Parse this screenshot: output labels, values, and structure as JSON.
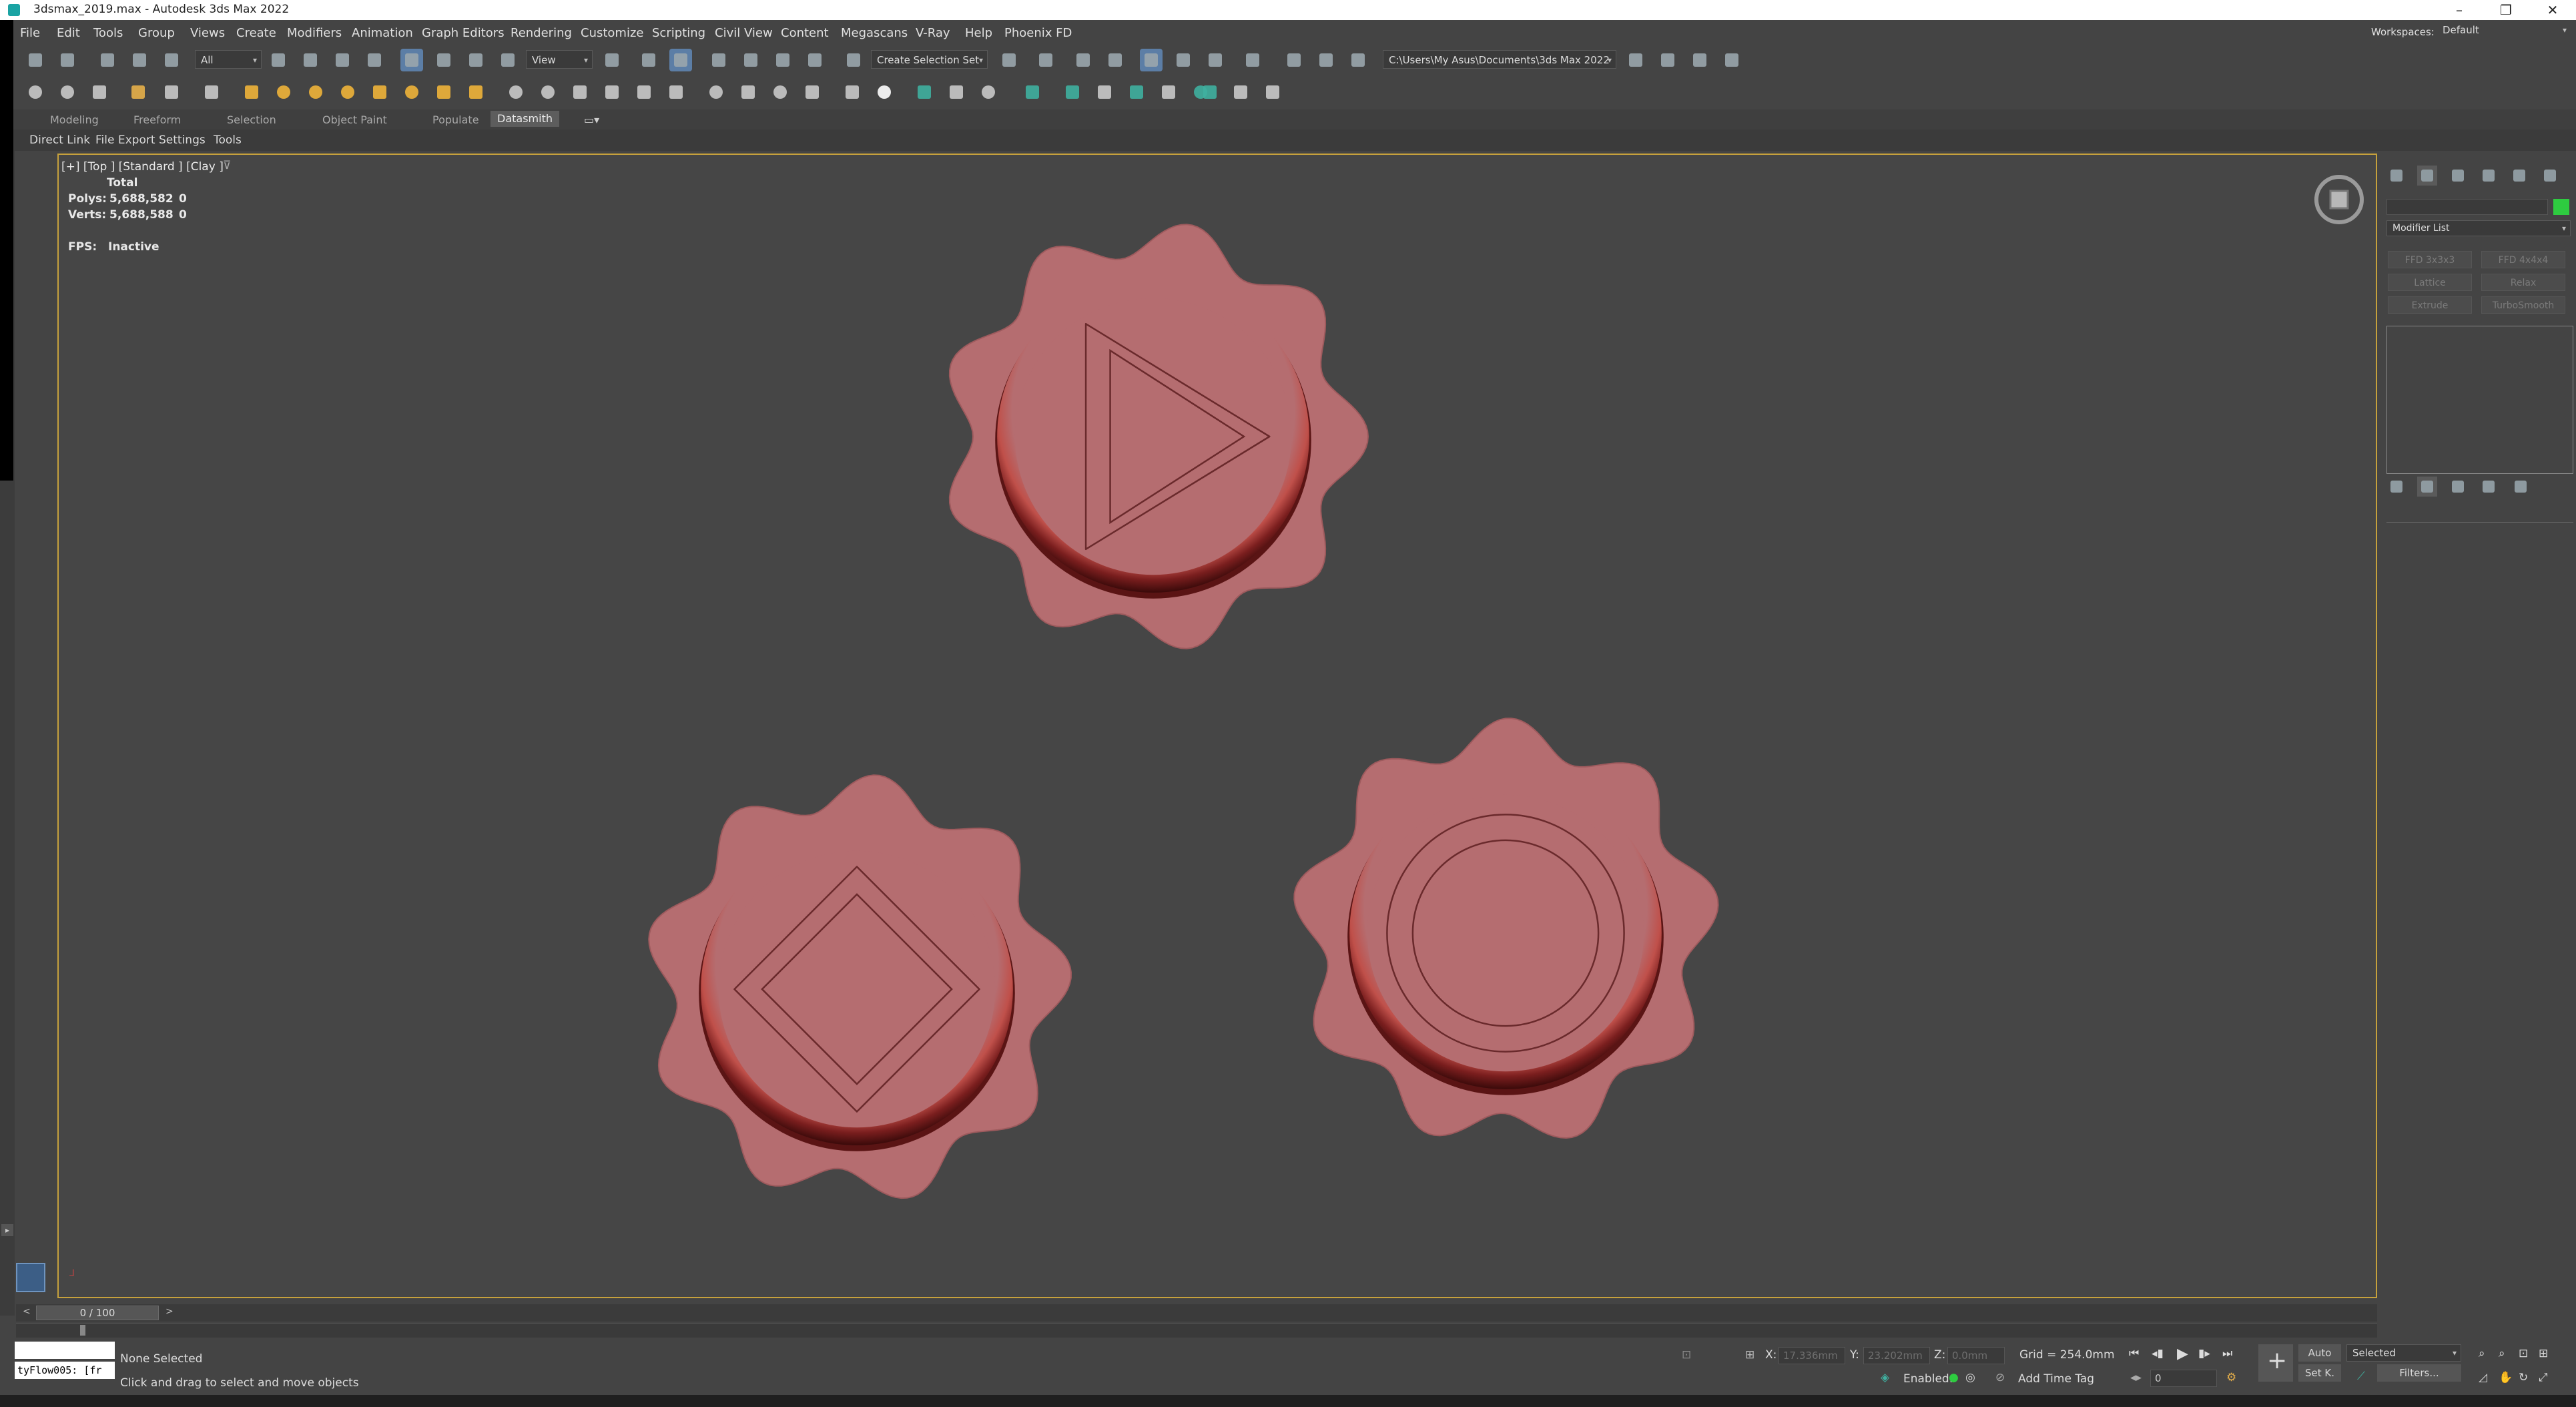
{
  "window": {
    "title": "3dsmax_2019.max - Autodesk 3ds Max 2022",
    "workspaces_label": "Workspaces:",
    "workspace_value": "Default"
  },
  "menubar": {
    "items": [
      "File",
      "Edit",
      "Tools",
      "Group",
      "Views",
      "Create",
      "Modifiers",
      "Animation",
      "Graph Editors",
      "Rendering",
      "Customize",
      "Scripting",
      "Civil View",
      "Content",
      "Megascans",
      "V-Ray",
      "Help",
      "Phoenix FD"
    ]
  },
  "toolbar": {
    "filter_value": "All",
    "refcoord_value": "View",
    "selection_set_placeholder": "Create Selection Set",
    "project_path": "C:\\Users\\My Asus\\Documents\\3ds Max 2022"
  },
  "ribbon": {
    "tabs": [
      "Modeling",
      "Freeform",
      "Selection",
      "Object Paint",
      "Populate",
      "Datasmith"
    ],
    "active_tab": "Datasmith",
    "subtabs": [
      "Direct Link",
      "File Export",
      "Settings",
      "Tools"
    ]
  },
  "viewport": {
    "label": "[+] [Top ] [Standard ] [Clay ]",
    "stats": {
      "total_label": "Total",
      "polys_label": "Polys:",
      "polys_value": "5,688,582",
      "polys_sel": "0",
      "verts_label": "Verts:",
      "verts_value": "5,688,588",
      "verts_sel": "0",
      "fps_label": "FPS:",
      "fps_value": "Inactive"
    },
    "seal_color": "#b56d70",
    "seal_rim_color": "#5a1414",
    "seals": [
      {
        "emblem": "triangle"
      },
      {
        "emblem": "diamond"
      },
      {
        "emblem": "circle"
      }
    ]
  },
  "command_panel": {
    "modifier_list": "Modifier List",
    "buttons": [
      "FFD 3x3x3",
      "FFD 4x4x4",
      "Lattice",
      "Relax",
      "Extrude",
      "TurboSmooth"
    ],
    "color_swatch": "#2ecc40"
  },
  "timeline": {
    "frame_counter": "0 / 100",
    "current_frame": "0"
  },
  "status": {
    "maxscript": "tyFlow005: [fr",
    "selection": "None Selected",
    "prompt": "Click and drag to select and move objects",
    "x_label": "X:",
    "x_value": "17.336mm",
    "y_label": "Y:",
    "y_value": "23.202mm",
    "z_label": "Z:",
    "z_value": "0.0mm",
    "grid": "Grid = 254.0mm",
    "enabled_label": "Enabled:",
    "add_time_tag": "Add Time Tag",
    "auto_label": "Auto",
    "setkey_label": "Set K.",
    "key_filter_value": "Selected",
    "filters_label": "Filters..."
  }
}
